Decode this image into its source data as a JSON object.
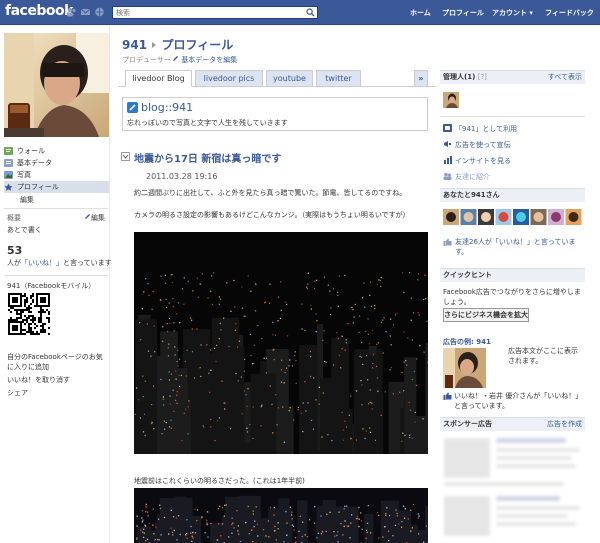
{
  "topbar": {
    "logo": "facebook",
    "search_placeholder": "検索",
    "nav": [
      "ホーム",
      "プロフィール",
      "アカウント ▾",
      "フィードバック"
    ]
  },
  "left": {
    "nav": [
      {
        "label": "ウォール",
        "icon": "wall-icon"
      },
      {
        "label": "基本データ",
        "icon": "info-icon"
      },
      {
        "label": "写真",
        "icon": "photos-icon"
      },
      {
        "label": "プロフィール",
        "icon": "profile-icon"
      }
    ],
    "edit": "編集",
    "summary_label": "概要",
    "summary_edit": "編集",
    "summary_text": "あとで書く",
    "likes_count": "53",
    "likes_text_1": "人が",
    "likes_text_link": "「いいね！」",
    "likes_text_2": "と言っています",
    "mobile_label": "941（Facebookモバイル）",
    "links": [
      "自分のFacebookページのお気に入りに追加",
      "いいね！を取り消す",
      "シェア"
    ]
  },
  "center": {
    "page_name": "941",
    "page_section": "プロフィール",
    "subtitle": "プロデューサー",
    "edit_basic": "基本データを編集",
    "tabs": [
      "livedoor Blog",
      "livedoor pics",
      "youtube",
      "twitter"
    ],
    "more_tabs": "»",
    "blog_title": "blog::941",
    "blog_desc": "忘れっぽいので写真と文字で人生を残していきます",
    "post_title": "地震から17日 新宿は真っ暗です",
    "post_date": "2011.03.28 19:16",
    "post_body_1": "約二週間ぶりに出社して、ふと外を見たら真っ暗で驚いた。節電、皆してるのですね。",
    "post_body_2": "カメラの明るさ設定の影響もあるけどこんなカンジ。（実際はもうちょい明るいですが）",
    "post_body_3": "地震前はこれくらいの明るさだった。(これは1年半前)"
  },
  "right": {
    "admins": "管理人(1)",
    "admins_help": "[?]",
    "see_all": "すべて表示",
    "actions": [
      {
        "label": "「941」として利用",
        "icon": "page-icon"
      },
      {
        "label": "広告を使って宣伝",
        "icon": "ads-icon"
      },
      {
        "label": "インサイトを見る",
        "icon": "insights-icon"
      },
      {
        "label": "友達に紹介",
        "icon": "friends-icon"
      }
    ],
    "you_and": "あなたと941さん",
    "friends_like_1": "友達26人が「いいね！」と言っていま",
    "friends_like_2": "す。",
    "quick_head": "クイックヒント",
    "quick_text": "Facebook広告でつながりをさらに増やしましょう。",
    "quick_button": "さらにビジネス機会を拡大",
    "ad_example": "広告の例: 941",
    "ad_text": "広告本文がここに表示されます。",
    "ad_like_1": "いいね！・岩井 優介さんが「いいね！」と言っています。",
    "sponsor_head": "スポンサー広告",
    "sponsor_create": "広告を作成"
  }
}
